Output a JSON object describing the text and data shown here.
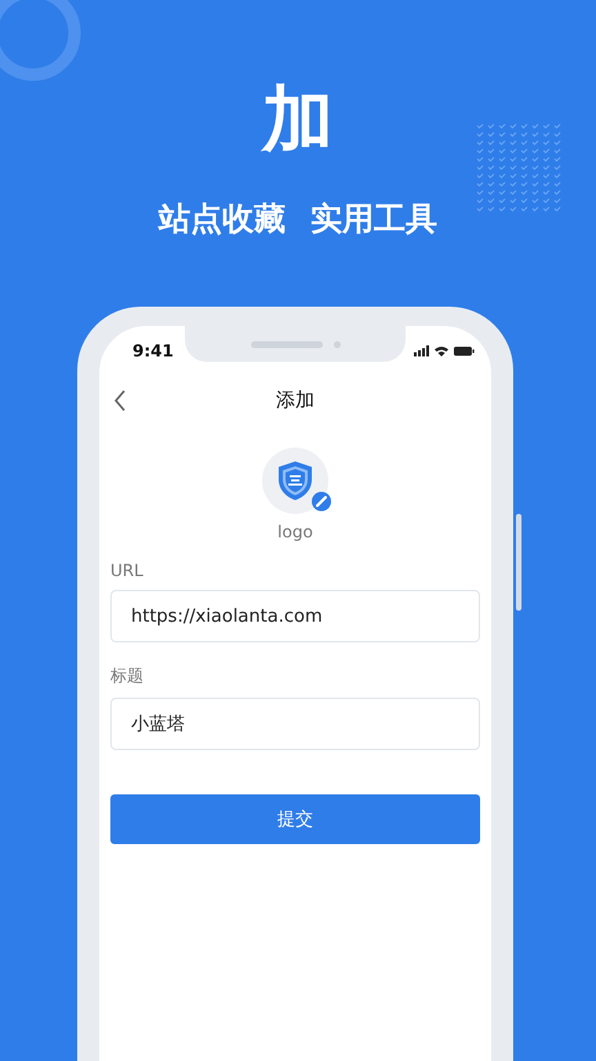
{
  "headline": "加",
  "taglines": [
    "站点收藏",
    "实用工具"
  ],
  "phone": {
    "status_time": "9:41",
    "nav_title": "添加",
    "logo_label": "logo",
    "fields": [
      {
        "label": "URL",
        "value": "https://xiaolanta.com"
      },
      {
        "label": "标题",
        "value": "小蓝塔"
      }
    ],
    "submit": "提交"
  }
}
